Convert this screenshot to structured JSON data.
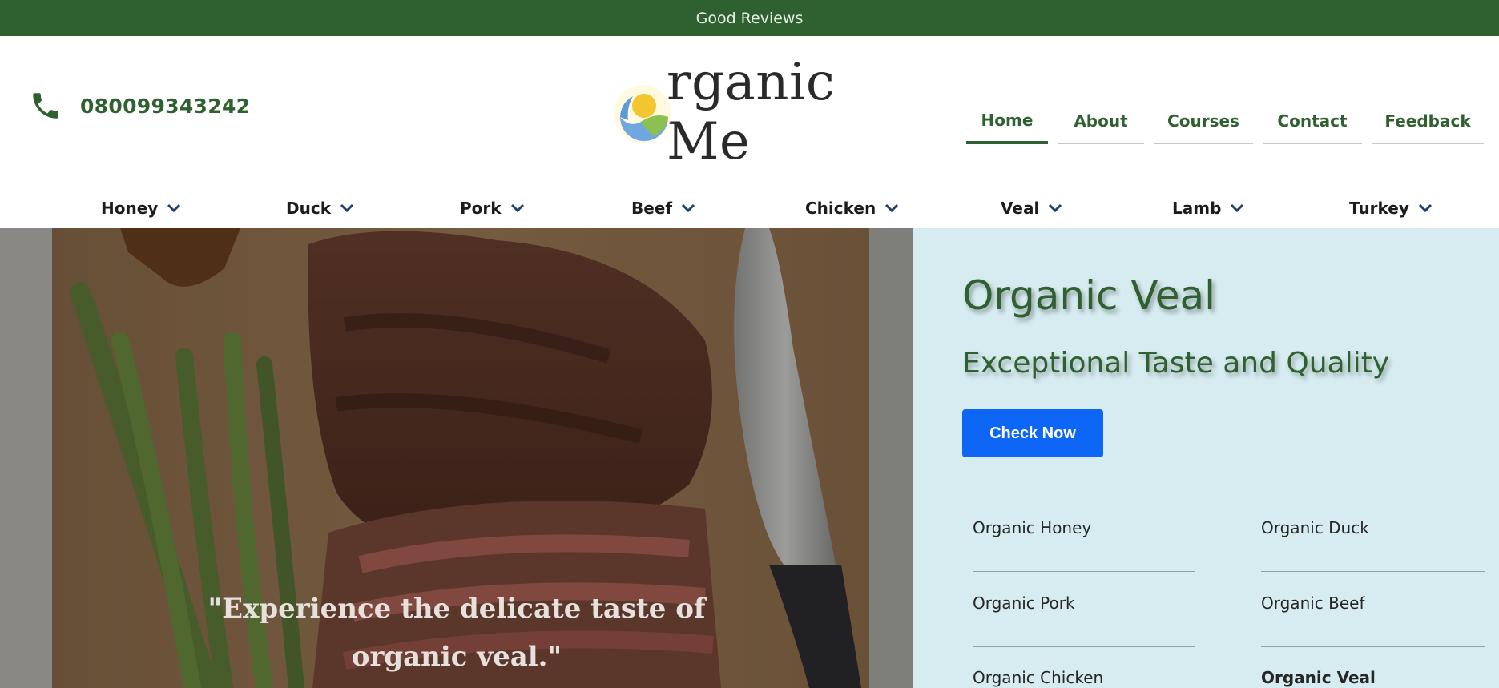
{
  "topbar": {
    "text": "Good Reviews"
  },
  "header": {
    "phone": "080099343242",
    "logo_text": "rganic Me"
  },
  "main_nav": [
    {
      "label": "Home",
      "active": true
    },
    {
      "label": "About",
      "active": false
    },
    {
      "label": "Courses",
      "active": false
    },
    {
      "label": "Contact",
      "active": false
    },
    {
      "label": "Feedback",
      "active": false
    }
  ],
  "categories": [
    {
      "label": "Honey"
    },
    {
      "label": "Duck"
    },
    {
      "label": "Pork"
    },
    {
      "label": "Beef"
    },
    {
      "label": "Chicken"
    },
    {
      "label": "Veal"
    },
    {
      "label": "Lamb"
    },
    {
      "label": "Turkey"
    }
  ],
  "hero": {
    "quote_line1": "\"Experience the delicate taste of",
    "quote_line2": "organic veal.\""
  },
  "panel": {
    "title": "Organic Veal",
    "subtitle": "Exceptional Taste and Quality",
    "cta": "Check Now",
    "links": [
      {
        "label": "Organic Honey",
        "active": false
      },
      {
        "label": "Organic Duck",
        "active": false
      },
      {
        "label": "Organic Pork",
        "active": false
      },
      {
        "label": "Organic Beef",
        "active": false
      },
      {
        "label": "Organic Chicken",
        "active": false
      },
      {
        "label": "Organic Veal",
        "active": true
      }
    ]
  },
  "colors": {
    "brand_green": "#2f6130",
    "cta_blue": "#0d66f5",
    "panel_bg": "#d6ecf0",
    "nav_chevron": "#1f3f6e"
  },
  "icons": [
    "phone-icon",
    "logo-sun-icon",
    "chevron-down-icon"
  ]
}
